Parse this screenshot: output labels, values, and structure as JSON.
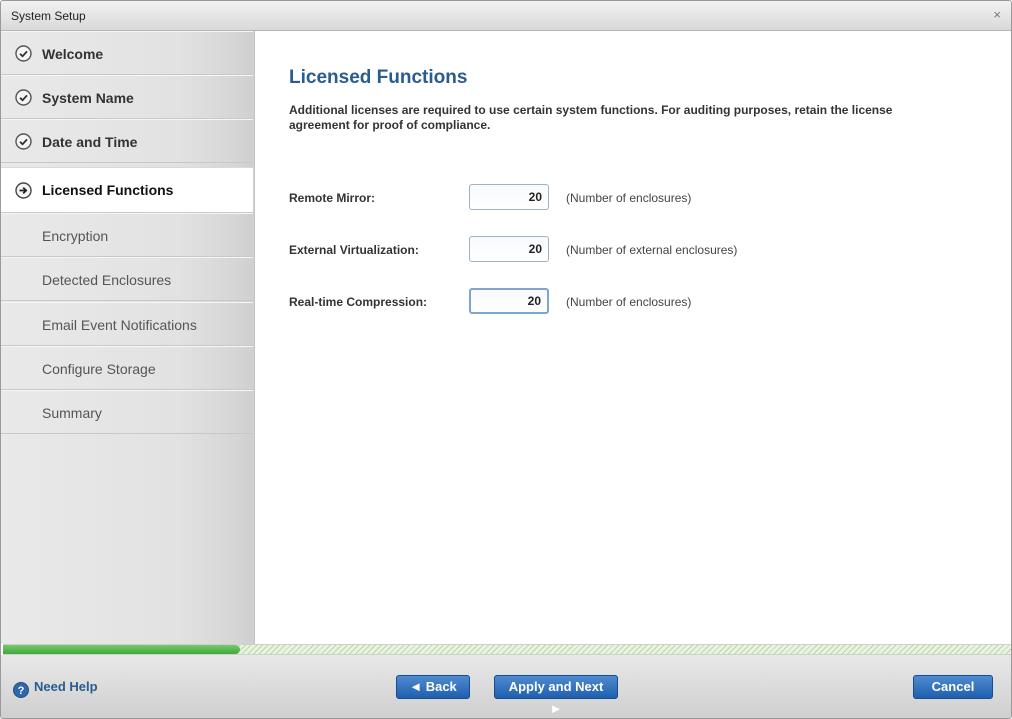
{
  "window": {
    "title": "System Setup",
    "close_glyph": "×"
  },
  "sidebar": {
    "items": [
      {
        "label": "Welcome",
        "state": "done",
        "icon": "check-circle-icon"
      },
      {
        "label": "System Name",
        "state": "done",
        "icon": "check-circle-icon"
      },
      {
        "label": "Date and Time",
        "state": "done",
        "icon": "check-circle-icon"
      },
      {
        "label": "Licensed Functions",
        "state": "current",
        "icon": "arrow-circle-icon"
      },
      {
        "label": "Encryption",
        "state": "todo"
      },
      {
        "label": "Detected Enclosures",
        "state": "todo"
      },
      {
        "label": "Email Event Notifications",
        "state": "todo"
      },
      {
        "label": "Configure Storage",
        "state": "todo"
      },
      {
        "label": "Summary",
        "state": "todo"
      }
    ]
  },
  "main": {
    "heading": "Licensed Functions",
    "description": "Additional licenses are required to use certain system functions. For auditing purposes, retain the license agreement for proof of compliance.",
    "fields": [
      {
        "label": "Remote Mirror:",
        "value": "20",
        "unit": "(Number of enclosures)"
      },
      {
        "label": "External Virtualization:",
        "value": "20",
        "unit": "(Number of external enclosures)"
      },
      {
        "label": "Real-time Compression:",
        "value": "20",
        "unit": "(Number of enclosures)"
      }
    ]
  },
  "progress": {
    "fraction": 0.235
  },
  "footer": {
    "help_label": "Need Help",
    "back_label": "◄ Back",
    "next_label": "Apply and Next ►",
    "cancel_label": "Cancel"
  },
  "colors": {
    "accent": "#2a5c8f",
    "button": "#1f5fae",
    "progress": "#3ea93a"
  }
}
